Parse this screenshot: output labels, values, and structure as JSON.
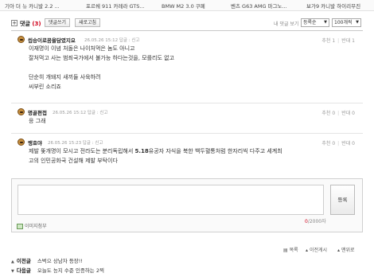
{
  "top_tabs": [
    "기아 더 뉴 카니발 2.2 ...",
    "포르쉐 911 카레라 GTS...",
    "BMW M2 3.0 쿠페",
    "벤츠 G63 AMG 마그노...",
    "보가9 카니발 하이리무진"
  ],
  "comment_header": {
    "label": "댓글",
    "count": "(3)",
    "write_button": "댓글쓰기",
    "refresh_button": "새로고침",
    "my_comments": "내 댓글 보기",
    "sort_select": "등록순",
    "per_page_select": "100개씩"
  },
  "comments": [
    {
      "nick": "씹승이로꿈을담였지요",
      "date": "26.05.26 15:12",
      "actions": "답글 : 신고",
      "up_label": "추천",
      "up": "1",
      "down_label": "반대",
      "down": "1",
      "lines": [
        "이재명이 이념 처돌은 나이처먹은 놈도 아니고",
        "잘처먹고 사는 범죄국가에서 불가능 하다는것을, 모를리도 없고",
        "",
        "단순히 개돼지 새끼들 사육하려",
        "씨부린 소리죠"
      ]
    },
    {
      "nick": "명골편접",
      "date": "26.05.26 15:12",
      "actions": "답글 : 신고",
      "up_label": "추천",
      "up": "0",
      "down_label": "반대",
      "down": "0",
      "lines": [
        "응 그래"
      ]
    },
    {
      "nick": "맹호야",
      "date": "26.05.26 15:23",
      "actions": "답글 : 신고",
      "up_label": "추천",
      "up": "0",
      "down_label": "반대",
      "down": "0",
      "line1_pre": "제발 똧개명이 모시고 전라도는 분리독립해서 ",
      "line1_bold": "5.18",
      "line1_post": "유공자 자식을 북한 백두혈통처럼 한자리씩 다주고 세계최",
      "line2": "고의 인민공화국 건설해 제발 부탁이다"
    }
  ],
  "write_box": {
    "submit": "등록",
    "attach_label": "이미지첨부",
    "count_current": "0",
    "count_max": "/2000자"
  },
  "post_nav": {
    "list": "목록",
    "prev_post": "이전게시",
    "top": "맨위로"
  },
  "prev_next": [
    {
      "key": "이전글",
      "title": "스벅으 상남자 등장!!"
    },
    {
      "key": "다음글",
      "title": "오늘도 능지 수준 인증하는 2찍"
    }
  ]
}
